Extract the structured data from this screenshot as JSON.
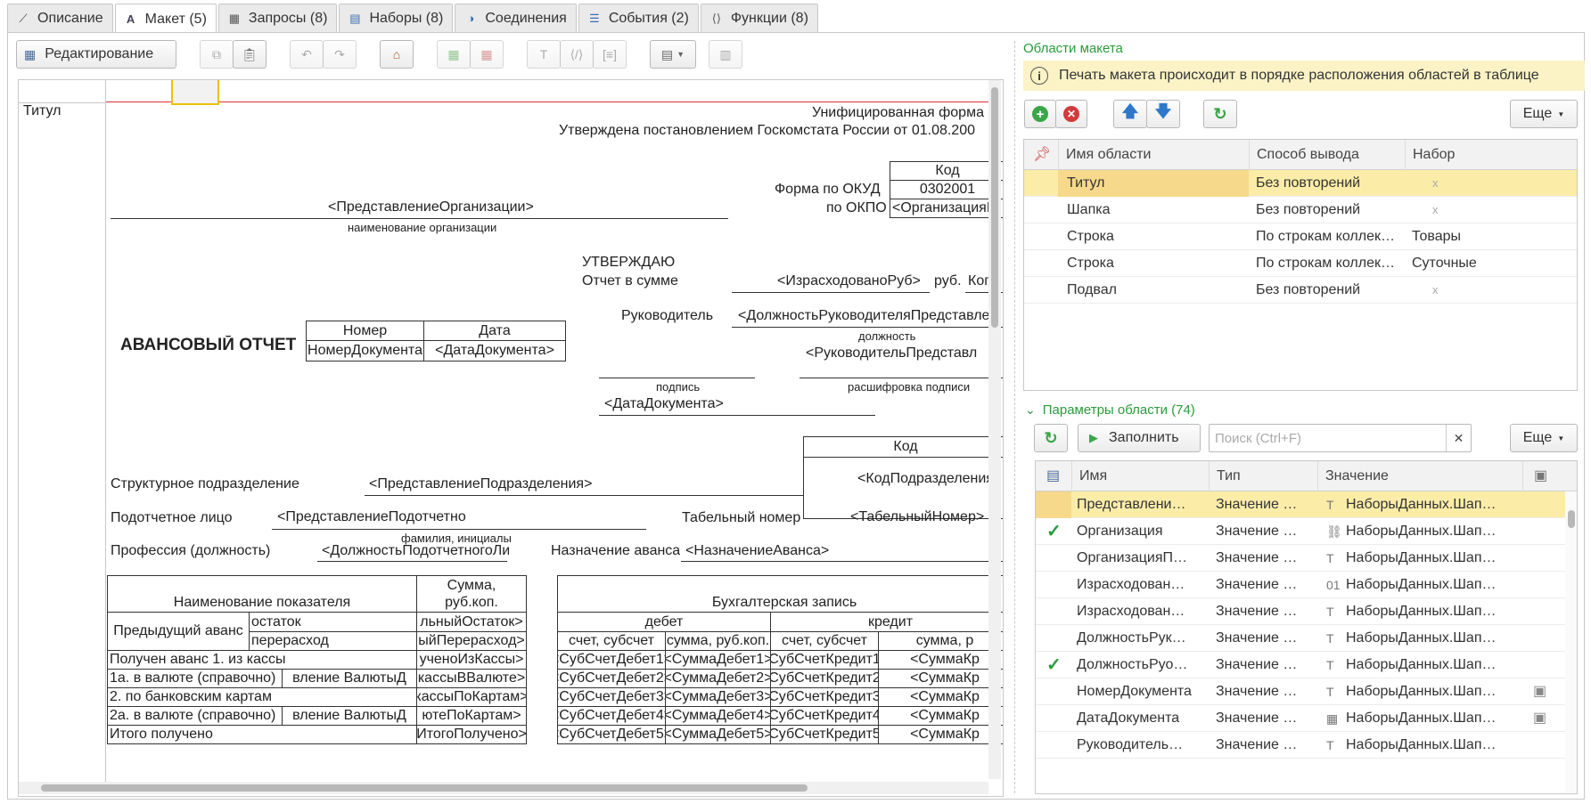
{
  "tabs": [
    {
      "icon": "wand-icon",
      "label": "Описание"
    },
    {
      "icon": "layout-icon",
      "label": "Макет (5)"
    },
    {
      "icon": "table-icon",
      "label": "Запросы (8)"
    },
    {
      "icon": "sets-icon",
      "label": "Наборы (8)"
    },
    {
      "icon": "connections-icon",
      "label": "Соединения"
    },
    {
      "icon": "events-icon",
      "label": "События (2)"
    },
    {
      "icon": "functions-icon",
      "label": "Функции (8)"
    }
  ],
  "toolbar": {
    "edit_label": "Редактирование"
  },
  "sheet": {
    "row_label": "Титул",
    "form_title": "Унифицированная форма N",
    "approved_by": "Утверждена постановлением Госкомстата России от  01.08.200",
    "code_header": "Код",
    "okud_label": "Форма по ОКУД",
    "okud_value": "0302001",
    "okpo_label": "по ОКПО",
    "okpo_value": "<ОрганизацияП",
    "org_param": "<ПредставлениеОрганизации>",
    "org_caption": "наименование организации",
    "approve": "УТВЕРЖДАЮ",
    "report_sum": "Отчет в сумме",
    "spent_rub": "<ИзрасходованоРуб>",
    "rub": "руб.",
    "kop": "Коп",
    "head": "Руководитель",
    "head_position": "<ДолжностьРуководителяПредставле",
    "position_caption": "должность",
    "report_title": "АВАНСОВЫЙ ОТЧЕТ",
    "number_header": "Номер",
    "date_header": "Дата",
    "number_value": "НомерДокумента",
    "date_value": "<ДатаДокумента>",
    "signature_caption": "подпись",
    "head_repr": "<РуководительПредставл",
    "decode_caption": "расшифровка подписи",
    "doc_date": "<ДатаДокумента>",
    "code_header2": "Код",
    "dept_label": "Структурное подразделение",
    "dept_value": "<ПредставлениеПодразделения>",
    "dept_code": "<КодПодразделения",
    "person_label": "Подотчетное лицо",
    "person_value": "<ПредставлениеПодотчетно",
    "tab_number_label": "Табельный номер",
    "tab_number_value": "<ТабельныйНомер>",
    "fio_caption": "фамилия, инициалы",
    "profession_label": "Профессия (должность)",
    "profession_value": "<ДолжностьПодотчетногоЛи",
    "purpose_label": "Назначение аванса",
    "purpose_value": "<НазначениеАванса>",
    "t1": {
      "h_name": "Наименование показателя",
      "h_sum1": "Сумма,",
      "h_sum2": "руб.коп.",
      "prev_advance": "Предыдущий аванс",
      "remainder": "остаток",
      "overspend": "перерасход",
      "remainder_v": "льныйОстаток>",
      "overspend_v": "ыйПерерасход>",
      "rows": [
        {
          "a": "Получен аванс 1. из кассы",
          "b": "",
          "c": "ученоИзКассы>"
        },
        {
          "a": "1а. в валюте (справочно)",
          "b": "вление ВалютыД",
          "c": "кассыВВалюте>"
        },
        {
          "a": "2. по банковским картам",
          "b": "",
          "c": "кассыПоКартам>"
        },
        {
          "a": "2а. в валюте (справочно)",
          "b": "вление ВалютыД",
          "c": "ютеПоКартам>"
        },
        {
          "a": "Итого получено",
          "b": "",
          "c": "ИтогоПолучено>"
        }
      ]
    },
    "t2": {
      "title": "Бухгалтерская запись",
      "debit": "дебет",
      "credit": "кредит",
      "acc": "счет, субсчет",
      "sum": "сумма, руб.коп.",
      "acc2": "счет, субсчет",
      "sum2": "сумма, р",
      "rows": [
        {
          "a": "<СубСчетДебет1>",
          "b": "<СуммаДебет1>",
          "c": "СубСчетКредит1",
          "d": "<СуммаКр"
        },
        {
          "a": "<СубСчетДебет2>",
          "b": "<СуммаДебет2>",
          "c": "СубСчетКредит2",
          "d": "<СуммаКр"
        },
        {
          "a": "<СубСчетДебет3>",
          "b": "<СуммаДебет3>",
          "c": "СубСчетКредит3",
          "d": "<СуммаКр"
        },
        {
          "a": "<СубСчетДебет4>",
          "b": "<СуммаДебет4>",
          "c": "СубСчетКредит4",
          "d": "<СуммаКр"
        },
        {
          "a": "<СубСчетДебет5>",
          "b": "<СуммаДебет5>",
          "c": "СубСчетКредит5",
          "d": "<СуммаКр"
        }
      ]
    }
  },
  "areas": {
    "title": "Области макета",
    "info": "Печать макета происходит в порядке расположения областей в таблице",
    "more": "Еще",
    "columns": [
      "Имя области",
      "Способ вывода",
      "Набор"
    ],
    "rows": [
      {
        "name": "Титул",
        "mode": "Без повторений",
        "set": "",
        "x": "x"
      },
      {
        "name": "Шапка",
        "mode": "Без повторений",
        "set": "",
        "x": "x"
      },
      {
        "name": "Строка",
        "mode": "По строкам коллек…",
        "set": "Товары",
        "x": ""
      },
      {
        "name": "Строка",
        "mode": "По строкам коллек…",
        "set": "Суточные",
        "x": ""
      },
      {
        "name": "Подвал",
        "mode": "Без повторений",
        "set": "",
        "x": "x"
      }
    ]
  },
  "params": {
    "title": "Параметры области (74)",
    "fill": "Заполнить",
    "search_placeholder": "Поиск (Ctrl+F)",
    "more": "Еще",
    "columns": [
      "Имя",
      "Тип",
      "Значение"
    ],
    "rows": [
      {
        "check": "",
        "name": "Представлени…",
        "type": "Значение …",
        "vicon": "T",
        "value": "НаборыДанных.Шап…",
        "extra": ""
      },
      {
        "check": "✓",
        "name": "Организация",
        "type": "Значение …",
        "vicon": "⛓",
        "value": "НаборыДанных.Шап…",
        "extra": ""
      },
      {
        "check": "",
        "name": "ОрганизацияП…",
        "type": "Значение …",
        "vicon": "T",
        "value": "НаборыДанных.Шап…",
        "extra": ""
      },
      {
        "check": "",
        "name": "Израсходован…",
        "type": "Значение …",
        "vicon": "01",
        "value": "НаборыДанных.Шап…",
        "extra": ""
      },
      {
        "check": "",
        "name": "Израсходован…",
        "type": "Значение …",
        "vicon": "T",
        "value": "НаборыДанных.Шап…",
        "extra": ""
      },
      {
        "check": "",
        "name": "ДолжностьРук…",
        "type": "Значение …",
        "vicon": "T",
        "value": "НаборыДанных.Шап…",
        "extra": ""
      },
      {
        "check": "✓",
        "name": "ДолжностьРуо…",
        "type": "Значение …",
        "vicon": "T",
        "value": "НаборыДанных.Шап…",
        "extra": ""
      },
      {
        "check": "",
        "name": "НомерДокумента",
        "type": "Значение …",
        "vicon": "T",
        "value": "НаборыДанных.Шап…",
        "extra": "▣"
      },
      {
        "check": "",
        "name": "ДатаДокумента",
        "type": "Значение …",
        "vicon": "▦",
        "value": "НаборыДанных.Шап…",
        "extra": "▣"
      },
      {
        "check": "",
        "name": "Руководитель…",
        "type": "Значение …",
        "vicon": "T",
        "value": "НаборыДанных.Шап…",
        "extra": ""
      }
    ]
  },
  "colors": {
    "accent": "#2a9b3a",
    "selection": "#fbeca8",
    "info_bg": "#fbf3c6"
  }
}
